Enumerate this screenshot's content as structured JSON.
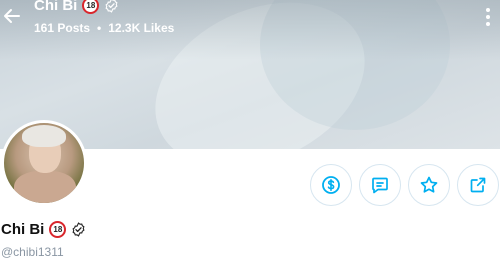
{
  "header": {
    "name": "Chi Bi",
    "age_badge": "18",
    "posts": "161 Posts",
    "separator": "•",
    "likes": "12.3K Likes"
  },
  "profile": {
    "name": "Chi Bi",
    "age_badge": "18",
    "username": "@chibi1311"
  },
  "actions": [
    {
      "icon": "dollar-icon"
    },
    {
      "icon": "message-icon"
    },
    {
      "icon": "star-icon"
    },
    {
      "icon": "share-icon"
    }
  ],
  "colors": {
    "accent": "#00aff0",
    "badge_ring": "#d9262c",
    "muted_text": "#8a96a3",
    "button_border": "#d7e6f0"
  }
}
